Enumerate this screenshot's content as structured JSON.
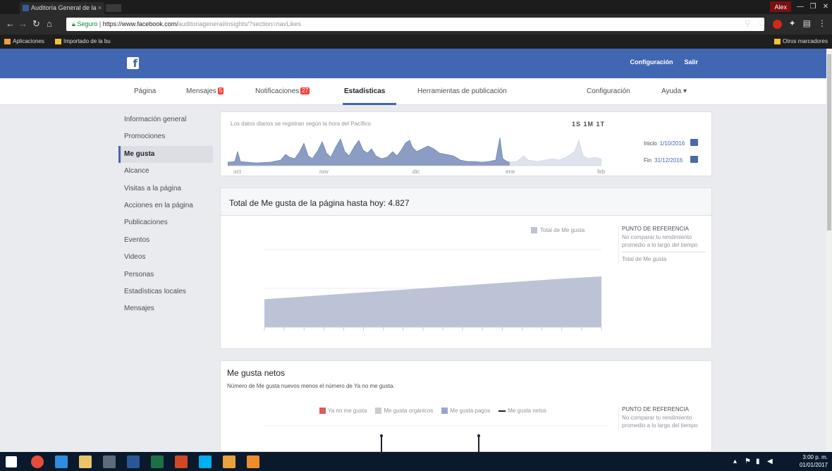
{
  "browser": {
    "tab_title": "Auditoría General de la",
    "tab_close": "×",
    "user_chip": "Alex",
    "window_buttons": [
      "—",
      "❐",
      "✕"
    ],
    "url_secure": "Seguro",
    "url_host": "https://www.facebook.com/",
    "url_path": "auditoriageneral/insights/?section=navLikes",
    "bookmarks": [
      "Aplicaciones",
      "Importado de la bu"
    ],
    "other_bookmarks": "Otros marcadores"
  },
  "facebook": {
    "logo": "f",
    "header_links": [
      "Configuración",
      "Salir"
    ]
  },
  "page_nav": {
    "items": [
      {
        "label": "Página"
      },
      {
        "label": "Mensajes",
        "badge": "5"
      },
      {
        "label": "Notificaciones",
        "badge": "27"
      },
      {
        "label": "Estadísticas"
      },
      {
        "label": "Herramientas de publicación"
      }
    ],
    "right": [
      "Configuración",
      "Ayuda ▾"
    ]
  },
  "sidebar": {
    "items": [
      "Información general",
      "Promociones",
      "Me gusta",
      "Alcance",
      "Visitas a la página",
      "Acciones en la página",
      "Publicaciones",
      "Eventos",
      "Videos",
      "Personas",
      "Estadísticas locales",
      "Mensajes"
    ],
    "active_index": 2
  },
  "timeline": {
    "note": "Los datos diarios se registran según la hora del Pacífico",
    "range": "1S 1M 1T",
    "axis_labels": [
      "oct",
      "nov",
      "dic",
      "ene",
      "feb"
    ],
    "start_label": "Inicio",
    "start_value": "1/10/2016",
    "end_label": "Fin",
    "end_value": "31/12/2016"
  },
  "total": {
    "title": "Total de Me gusta de la página hasta hoy: 4.827"
  },
  "likes_chart": {
    "legend": "Total de Me gusta",
    "legend_color": "#bcc3d6",
    "benchmark_title": "PUNTO DE REFERENCIA",
    "benchmark_desc": "No comparar tu rendimiento promedio a lo largo del tiempo",
    "benchmark_item": "Total de Me gusta"
  },
  "net_likes": {
    "title": "Me gusta netos",
    "subtitle": "Número de Me gusta nuevos menos el número de Ya no me gusta.",
    "legend": [
      {
        "label": "Ya no me gusta",
        "color": "#e05a5a"
      },
      {
        "label": "Me gusta orgánicos",
        "color": "#c9ccd4"
      },
      {
        "label": "Me gusta pagos",
        "color": "#9aa6c8"
      },
      {
        "label": "Me gusta netos",
        "color": "#1d2129"
      }
    ],
    "benchmark_title": "PUNTO DE REFERENCIA",
    "benchmark_desc": "No comparar tu rendimiento promedio a lo largo del tiempo"
  },
  "taskbar": {
    "time": "3:00 p. m.",
    "date": "01/01/2017"
  },
  "chart_data": {
    "type": "area",
    "series": [
      {
        "name": "Total de Me gusta",
        "values": [
          4680,
          4695,
          4710,
          4725,
          4740,
          4755,
          4770,
          4785,
          4800,
          4815,
          4827
        ]
      }
    ]
  }
}
